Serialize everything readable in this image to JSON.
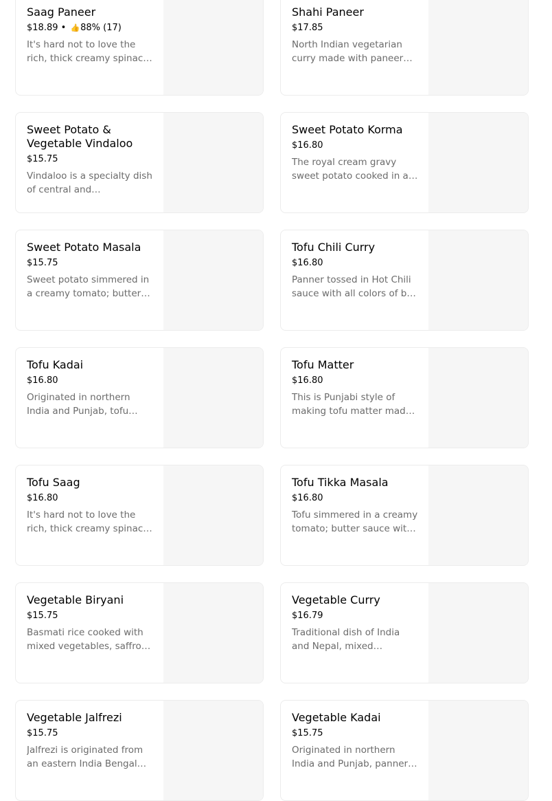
{
  "menu": {
    "items": [
      {
        "id": "saag-paneer",
        "name": "Saag Paneer",
        "price": "$18.89",
        "rating": "88% (17)",
        "desc": "It's hard not to love the rich, thick creamy spinach with paneer"
      },
      {
        "id": "shahi-paneer",
        "name": "Shahi Paneer",
        "price": "$17.85",
        "rating": "",
        "desc": "North Indian vegetarian curry made with paneer cheese"
      },
      {
        "id": "sweet-potato-vegetable-vindaloo",
        "name": "Sweet Potato & Vegetable Vindaloo",
        "price": "$15.75",
        "rating": "",
        "desc": "Vindaloo is a specialty dish of central and southwestern India"
      },
      {
        "id": "sweet-potato-korma",
        "name": "Sweet Potato Korma",
        "price": "$16.80",
        "rating": "",
        "desc": "The royal cream gravy sweet potato cooked in a rich sauce"
      },
      {
        "id": "sweet-potato-masala",
        "name": "Sweet Potato Masala",
        "price": "$15.75",
        "rating": "",
        "desc": "Sweet potato simmered in a creamy tomato; butter sauce with spices"
      },
      {
        "id": "tofu-chili-curry",
        "name": "Tofu Chili Curry",
        "price": "$16.80",
        "rating": "",
        "desc": "Panner tossed in Hot Chili sauce with all colors of bell peppers"
      },
      {
        "id": "tofu-kadai",
        "name": "Tofu Kadai",
        "price": "$16.80",
        "rating": "",
        "desc": "Originated in northern India and Punjab, tofu kadai is cooked with peppers"
      },
      {
        "id": "tofu-matter",
        "name": "Tofu Matter",
        "price": "$16.80",
        "rating": "",
        "desc": "This is Punjabi style of making tofu matter made with green peas"
      },
      {
        "id": "tofu-saag",
        "name": "Tofu Saag",
        "price": "$16.80",
        "rating": "",
        "desc": "It's hard not to love the rich, thick creamy spinach. Tofu cooked in it"
      },
      {
        "id": "tofu-tikka-masala",
        "name": "Tofu Tikka Masala",
        "price": "$16.80",
        "rating": "",
        "desc": "Tofu simmered in a creamy tomato; butter sauce with spices"
      },
      {
        "id": "vegetable-biryani",
        "name": "Vegetable Biryani",
        "price": "$15.75",
        "rating": "",
        "desc": "Basmati rice cooked with mixed vegetables, saffron, and spices"
      },
      {
        "id": "vegetable-curry",
        "name": "Vegetable Curry",
        "price": "$16.79",
        "rating": "",
        "desc": "Traditional dish of India and Nepal, mixed vegetable like carrots and beans"
      },
      {
        "id": "vegetable-jalfrezi",
        "name": "Vegetable Jalfrezi",
        "price": "$15.75",
        "rating": "",
        "desc": "Jalfrezi is originated from an eastern India Bengal region dish"
      },
      {
        "id": "vegetable-kadai",
        "name": "Vegetable Kadai",
        "price": "$15.75",
        "rating": "",
        "desc": "Originated in northern India and Punjab, panner kadai is cooked with peppers"
      }
    ]
  },
  "icons": {
    "rating_icon": "thumbs-up-icon"
  },
  "colors": {
    "card_border": "#ececec",
    "image_placeholder": "#f6f6f6",
    "description_text": "#6b6b6b"
  }
}
